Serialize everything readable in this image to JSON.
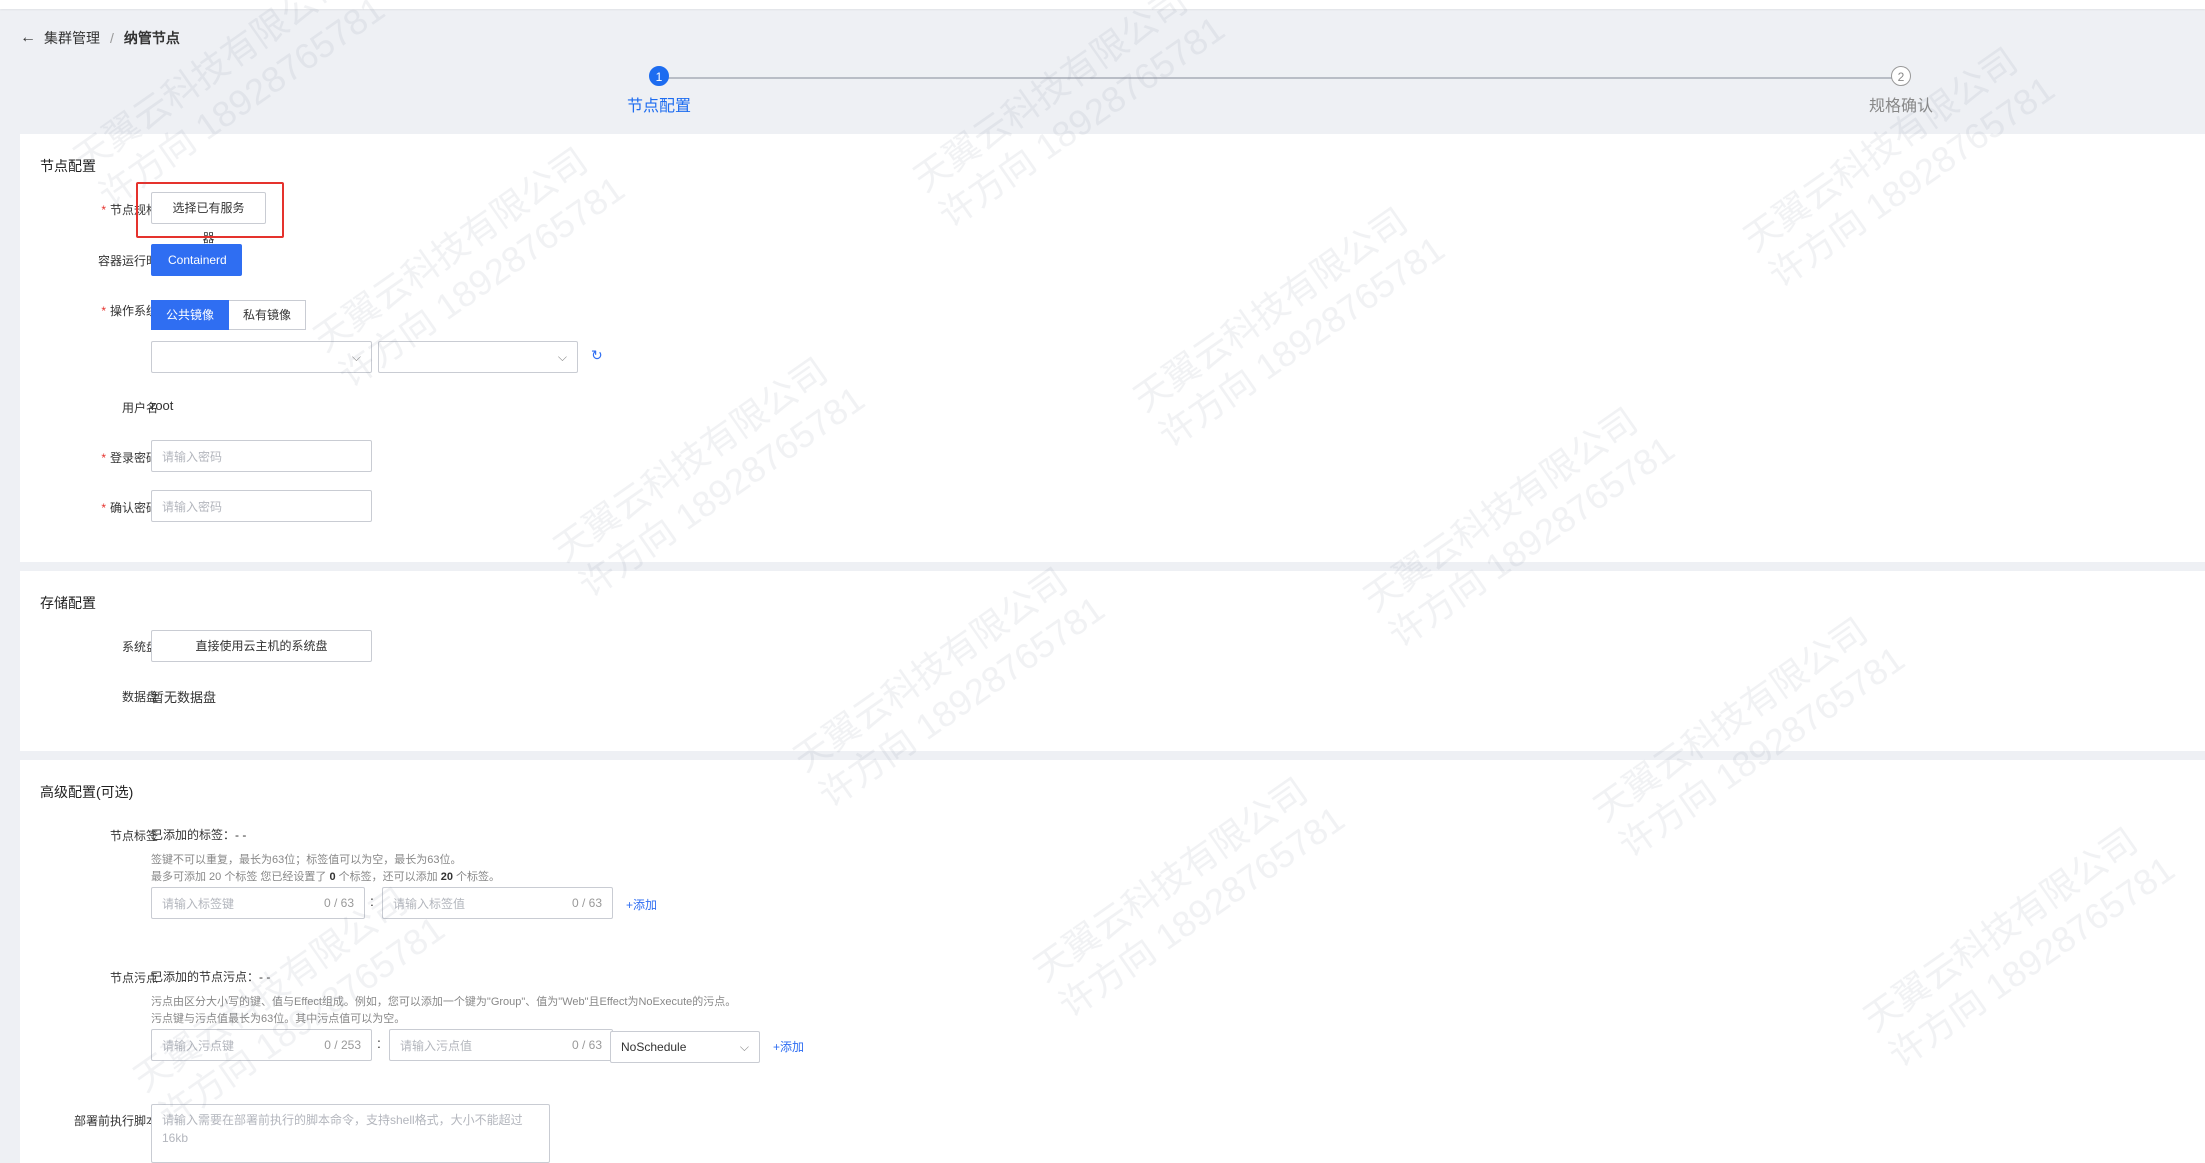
{
  "breadcrumb": {
    "parent": "集群管理",
    "separator": "/",
    "current": "纳管节点"
  },
  "steps": [
    {
      "num": "1",
      "label": "节点配置"
    },
    {
      "num": "2",
      "label": "规格确认"
    }
  ],
  "node_config": {
    "title": "节点配置",
    "spec_label": "节点规格",
    "spec_button": "选择已有服务器",
    "runtime_label": "容器运行时",
    "runtime_value": "Containerd",
    "os_label": "操作系统",
    "os_public": "公共镜像",
    "os_private": "私有镜像",
    "username_label": "用户名",
    "username_value": "root",
    "password_label": "登录密码",
    "password_placeholder": "请输入密码",
    "confirm_label": "确认密码",
    "confirm_placeholder": "请输入密码"
  },
  "storage": {
    "title": "存储配置",
    "system_disk_label": "系统盘",
    "system_disk_button": "直接使用云主机的系统盘",
    "data_disk_label": "数据盘",
    "data_disk_value": "暂无数据盘"
  },
  "advanced": {
    "title": "高级配置(可选)",
    "labels_label": "节点标签",
    "labels_added": "已添加的标签：- -",
    "labels_hint1": "签键不可以重复，最长为63位；标签值可以为空，最长为63位。",
    "labels_hint2_pre": "最多可添加 20 个标签 您已经设置了 ",
    "labels_hint2_set": "0",
    "labels_hint2_mid": " 个标签，还可以添加 ",
    "labels_hint2_left": "20",
    "labels_hint2_post": " 个标签。",
    "label_key_placeholder": "请输入标签键",
    "label_key_count": "0 / 63",
    "label_value_placeholder": "请输入标签值",
    "label_value_count": "0 / 63",
    "add_text": "+添加",
    "taints_label": "节点污点",
    "taints_added": "已添加的节点污点：- -",
    "taints_hint1": "污点由区分大小写的键、值与Effect组成。例如，您可以添加一个键为\"Group\"、值为\"Web\"且Effect为NoExecute的污点。",
    "taints_hint2": "污点键与污点值最长为63位。其中污点值可以为空。",
    "taint_key_placeholder": "请输入污点键",
    "taint_key_count": "0 / 253",
    "taint_value_placeholder": "请输入污点值",
    "taint_value_count": "0 / 63",
    "taint_effect": "NoSchedule",
    "script_label": "部署前执行脚本",
    "script_placeholder": "请输入需要在部署前执行的脚本命令，支持shell格式，大小不能超过16kb"
  },
  "colon": ":",
  "watermark": [
    "天翼云科技有限公司",
    "许方向 18928765781"
  ],
  "colors": {
    "primary": "#2f6ef2",
    "required": "#e5322d",
    "highlight_box": "#e5322d"
  }
}
